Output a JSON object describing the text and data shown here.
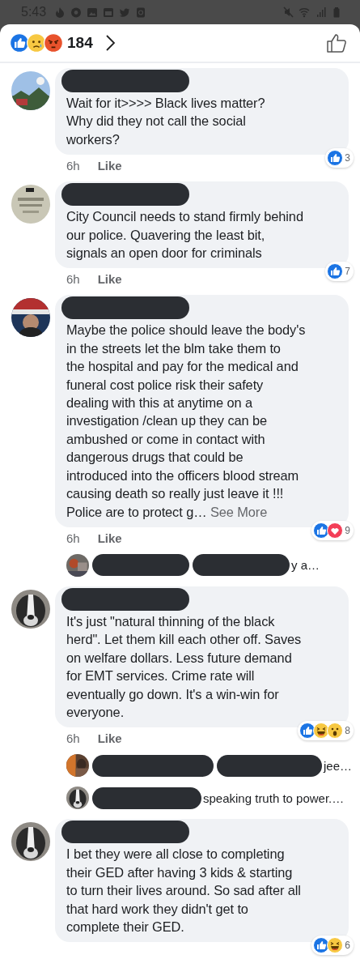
{
  "status_bar": {
    "time": "5:43"
  },
  "header": {
    "reactions": [
      {
        "kind": "like"
      },
      {
        "kind": "sad"
      },
      {
        "kind": "angry"
      }
    ],
    "count": "184"
  },
  "comments": [
    {
      "kind": "comment",
      "text": "Wait for it>>>> Black lives matter?\nWhy  did they not call the social\nworkers?",
      "time": "6h",
      "action": "Like",
      "reactions": [
        {
          "kind": "like"
        }
      ],
      "reaction_count": "3"
    },
    {
      "kind": "comment",
      "text": "City Council needs to stand firmly behind\nour police. Quavering the least bit,\nsignals an open door for criminals",
      "time": "6h",
      "action": "Like",
      "reactions": [
        {
          "kind": "like"
        }
      ],
      "reaction_count": "7"
    },
    {
      "kind": "comment",
      "text": "Maybe the police should leave the body's\nin the streets let the blm take them to\nthe hospital and pay for the medical and\nfuneral cost police risk their safety\ndealing with this at anytime on a\ninvestigation /clean up they can be\nambushed or come in contact with\ndangerous drugs that could be\nintroduced into the officers blood stream\ncausing death so really just leave it !!!\nPolice are to protect g…",
      "see_more": "See More",
      "time": "6h",
      "action": "Like",
      "reactions": [
        {
          "kind": "like"
        },
        {
          "kind": "love"
        }
      ],
      "reaction_count": "9"
    },
    {
      "kind": "reply",
      "text": "y a…"
    },
    {
      "kind": "comment",
      "text": "It's just \"natural thinning of the black\nherd\". Let them kill each other off. Saves\non welfare dollars. Less future demand\nfor EMT services. Crime rate will\neventually go down. It's a win-win for\neveryone.",
      "time": "6h",
      "action": "Like",
      "reactions": [
        {
          "kind": "like"
        },
        {
          "kind": "haha"
        },
        {
          "kind": "wow"
        }
      ],
      "reaction_count": "8"
    },
    {
      "kind": "reply",
      "text": "jee…"
    },
    {
      "kind": "reply",
      "text": "speaking truth to power.…"
    },
    {
      "kind": "comment",
      "text": "I bet they were all close to completing\ntheir GED after having 3 kids & starting\nto turn their lives around. So sad after all\nthat hard work they didn't get to\ncomplete their GED.",
      "reactions": [
        {
          "kind": "like"
        },
        {
          "kind": "haha"
        }
      ],
      "reaction_count": "6"
    }
  ]
}
